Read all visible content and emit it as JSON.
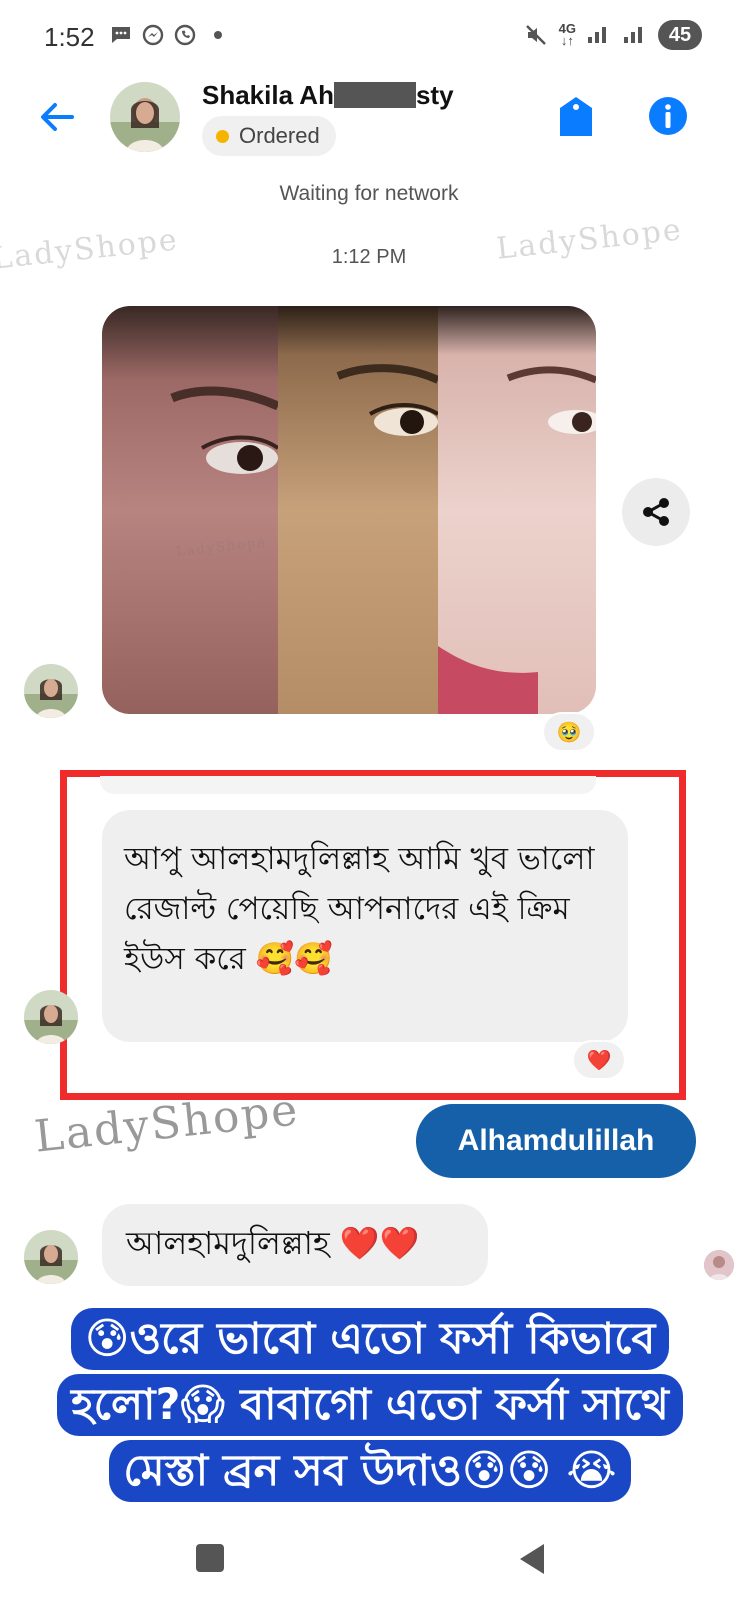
{
  "status_bar": {
    "time": "1:52",
    "network": "4G",
    "battery": "45",
    "icons": [
      "chat-bubble-icon",
      "messenger-icon",
      "whatsapp-icon",
      "mute-icon",
      "signal-icon",
      "signal-icon"
    ]
  },
  "header": {
    "contact_name_prefix": "Shakila Ah",
    "contact_name_suffix": "sty",
    "status_label": "Ordered",
    "status_color": "#f5b400",
    "accent": "#0a7cff"
  },
  "conversation": {
    "network_notice": "Waiting for network",
    "timestamp": "1:12 PM",
    "watermark": "LadyShope",
    "photo_reaction": "🥹",
    "received_message_1": "আপু আলহামদুলিল্লাহ আমি খুব ভালো রেজাল্ট পেয়েছি আপনাদের এই ক্রিম ইউস করে 🥰🥰",
    "received_message_1_reaction": "❤️",
    "sent_message": "Alhamdulillah",
    "received_message_2": "আলহামদুলিল্লাহ ❤️❤️"
  },
  "overlay": {
    "caption": "😰ওরে ভাবো এতো ফর্সা কিভাবে হলো?😱 বাবাগো এতো ফর্সা সাথে মেস্তা ব্রন সব উদাও😰😰 😭",
    "background": "#1947c6"
  }
}
